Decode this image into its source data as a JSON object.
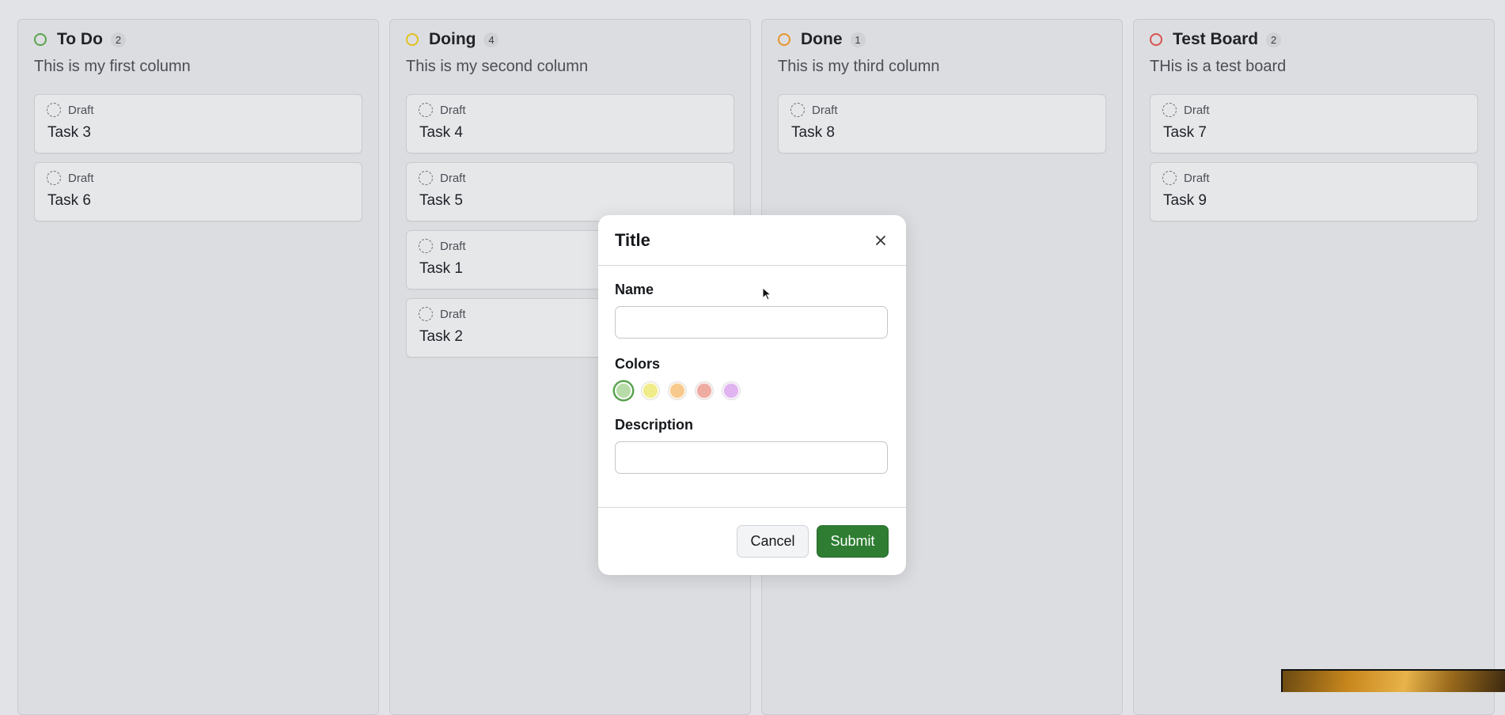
{
  "columns": [
    {
      "title": "To Do",
      "count": "2",
      "description": "This is my first column",
      "color": "#5aa34f",
      "cards": [
        {
          "status": "Draft",
          "title": "Task 3"
        },
        {
          "status": "Draft",
          "title": "Task 6"
        }
      ]
    },
    {
      "title": "Doing",
      "count": "4",
      "description": "This is my second column",
      "color": "#e0c21e",
      "cards": [
        {
          "status": "Draft",
          "title": "Task 4"
        },
        {
          "status": "Draft",
          "title": "Task 5"
        },
        {
          "status": "Draft",
          "title": "Task 1"
        },
        {
          "status": "Draft",
          "title": "Task 2"
        }
      ]
    },
    {
      "title": "Done",
      "count": "1",
      "description": "This is my third column",
      "color": "#e8952d",
      "cards": [
        {
          "status": "Draft",
          "title": "Task 8"
        }
      ]
    },
    {
      "title": "Test Board",
      "count": "2",
      "description": "THis is a test board",
      "color": "#d9534f",
      "cards": [
        {
          "status": "Draft",
          "title": "Task 7"
        },
        {
          "status": "Draft",
          "title": "Task 9"
        }
      ]
    }
  ],
  "modal": {
    "title": "Title",
    "close_icon": "close-icon",
    "name_label": "Name",
    "name_value": "",
    "colors_label": "Colors",
    "colors": [
      {
        "name": "green",
        "hex": "#b7dca7",
        "selected": true
      },
      {
        "name": "yellow",
        "hex": "#f1ec8a",
        "selected": false
      },
      {
        "name": "orange",
        "hex": "#f8c98c",
        "selected": false
      },
      {
        "name": "red",
        "hex": "#eeaba2",
        "selected": false
      },
      {
        "name": "purple",
        "hex": "#dfb4f0",
        "selected": false
      }
    ],
    "description_label": "Description",
    "description_value": "",
    "cancel_label": "Cancel",
    "submit_label": "Submit"
  }
}
